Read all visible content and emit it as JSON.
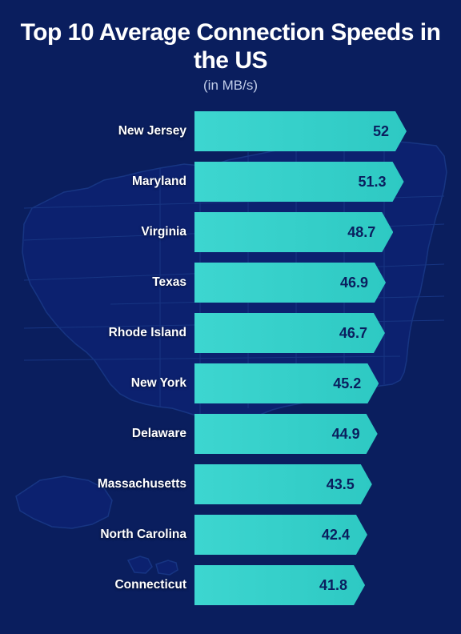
{
  "page": {
    "title": "Top 10 Average Connection Speeds in the US",
    "subtitle": "(in MB/s)",
    "background_color": "#0a1e5e",
    "bar_color": "#3dd6d0"
  },
  "bars": [
    {
      "state": "New Jersey",
      "value": "52",
      "width_pct": 100
    },
    {
      "state": "Maryland",
      "value": "51.3",
      "width_pct": 98.7
    },
    {
      "state": "Virginia",
      "value": "48.7",
      "width_pct": 93.7
    },
    {
      "state": "Texas",
      "value": "46.9",
      "width_pct": 90.2
    },
    {
      "state": "Rhode Island",
      "value": "46.7",
      "width_pct": 89.8
    },
    {
      "state": "New York",
      "value": "45.2",
      "width_pct": 86.9
    },
    {
      "state": "Delaware",
      "value": "44.9",
      "width_pct": 86.3
    },
    {
      "state": "Massachusetts",
      "value": "43.5",
      "width_pct": 83.7
    },
    {
      "state": "North Carolina",
      "value": "42.4",
      "width_pct": 81.5
    },
    {
      "state": "Connecticut",
      "value": "41.8",
      "width_pct": 80.4
    }
  ]
}
